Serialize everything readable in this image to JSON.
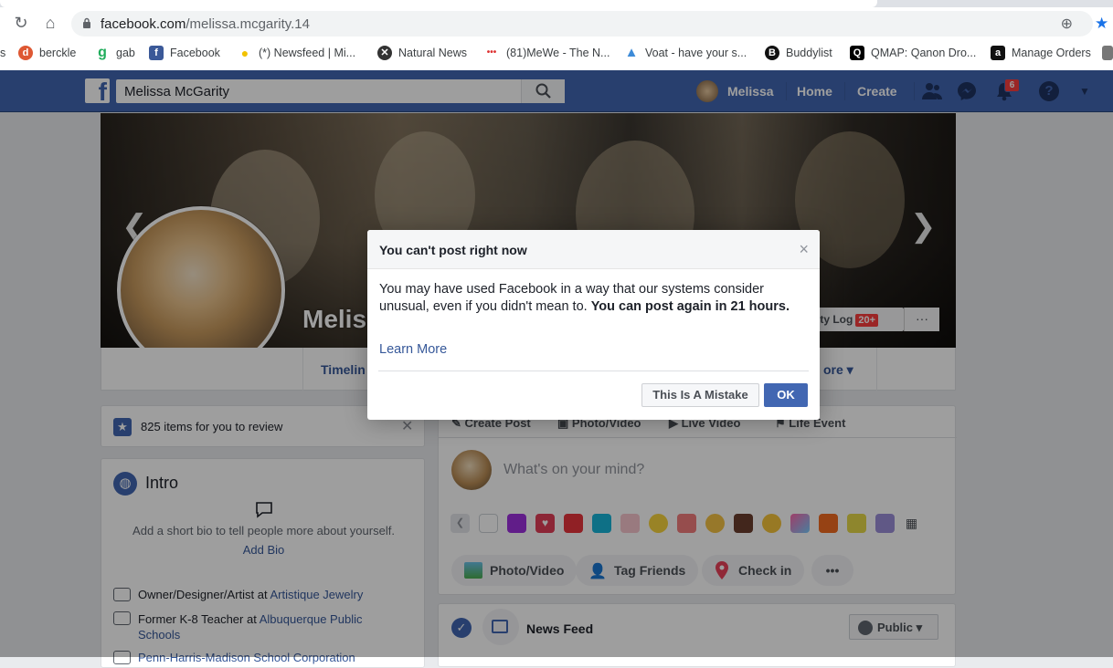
{
  "browser": {
    "url_host": "facebook.com",
    "url_path": "/melissa.mcgarity.14",
    "bookmarks": [
      {
        "label": "s",
        "icon": ""
      },
      {
        "label": "berckle",
        "icon": "duckduckgo-icon"
      },
      {
        "label": "gab",
        "icon": "gab-icon"
      },
      {
        "label": "Facebook",
        "icon": "facebook-icon"
      },
      {
        "label": "(*) Newsfeed | Mi...",
        "icon": "lightbulb-icon"
      },
      {
        "label": "Natural News",
        "icon": "natural-news-icon"
      },
      {
        "label": "(81)MeWe - The N...",
        "icon": "mewe-icon"
      },
      {
        "label": "Voat - have your s...",
        "icon": "voat-icon"
      },
      {
        "label": "Buddylist",
        "icon": "buddylist-icon"
      },
      {
        "label": "QMAP: Qanon Dro...",
        "icon": "qmap-icon"
      },
      {
        "label": "Manage Orders",
        "icon": "amazon-icon"
      }
    ]
  },
  "fb": {
    "logo": "f",
    "search_value": "Melissa McGarity",
    "user_name": "Melissa",
    "nav_home": "Home",
    "nav_create": "Create",
    "notifications_count": "6",
    "profile_name": "Meliss",
    "activity_log": "ity Log",
    "activity_badge": "20+",
    "more_dots": "···",
    "tab_timeline": "Timelin",
    "tab_more": "ore ▾",
    "review_text": "825 items for you to review",
    "intro_title": "Intro",
    "intro_bio": "Add a short bio to tell people more about yourself.",
    "add_bio": "Add Bio",
    "work": [
      {
        "prefix": "Owner/Designer/Artist at ",
        "link": "Artistique Jewelry"
      },
      {
        "prefix": "Former K-8 Teacher at ",
        "link": "Albuquerque Public Schools"
      },
      {
        "prefix": "",
        "link": "Penn-Harris-Madison School Corporation"
      }
    ],
    "composer_tabs": [
      "Create Post",
      "Photo/Video",
      "Live Video",
      "Life Event"
    ],
    "composer_placeholder": "What's on your mind?",
    "pill_photo": "Photo/Video",
    "pill_tag": "Tag Friends",
    "pill_checkin": "Check in",
    "pill_more": "•••",
    "newsfeed_label": "News Feed",
    "public_label": "Public ▾"
  },
  "dialog": {
    "title": "You can't post right now",
    "close": "×",
    "body_plain": "You may have used Facebook in a way that our systems consider unusual, even if you didn't mean to. ",
    "body_bold": "You can post again in 21 hours.",
    "learn_more": "Learn More",
    "mistake_button": "This Is A Mistake",
    "ok_button": "OK"
  },
  "colors": {
    "fb_blue": "#4267b2",
    "link_blue": "#365899",
    "badge_red": "#fa3e3e"
  }
}
